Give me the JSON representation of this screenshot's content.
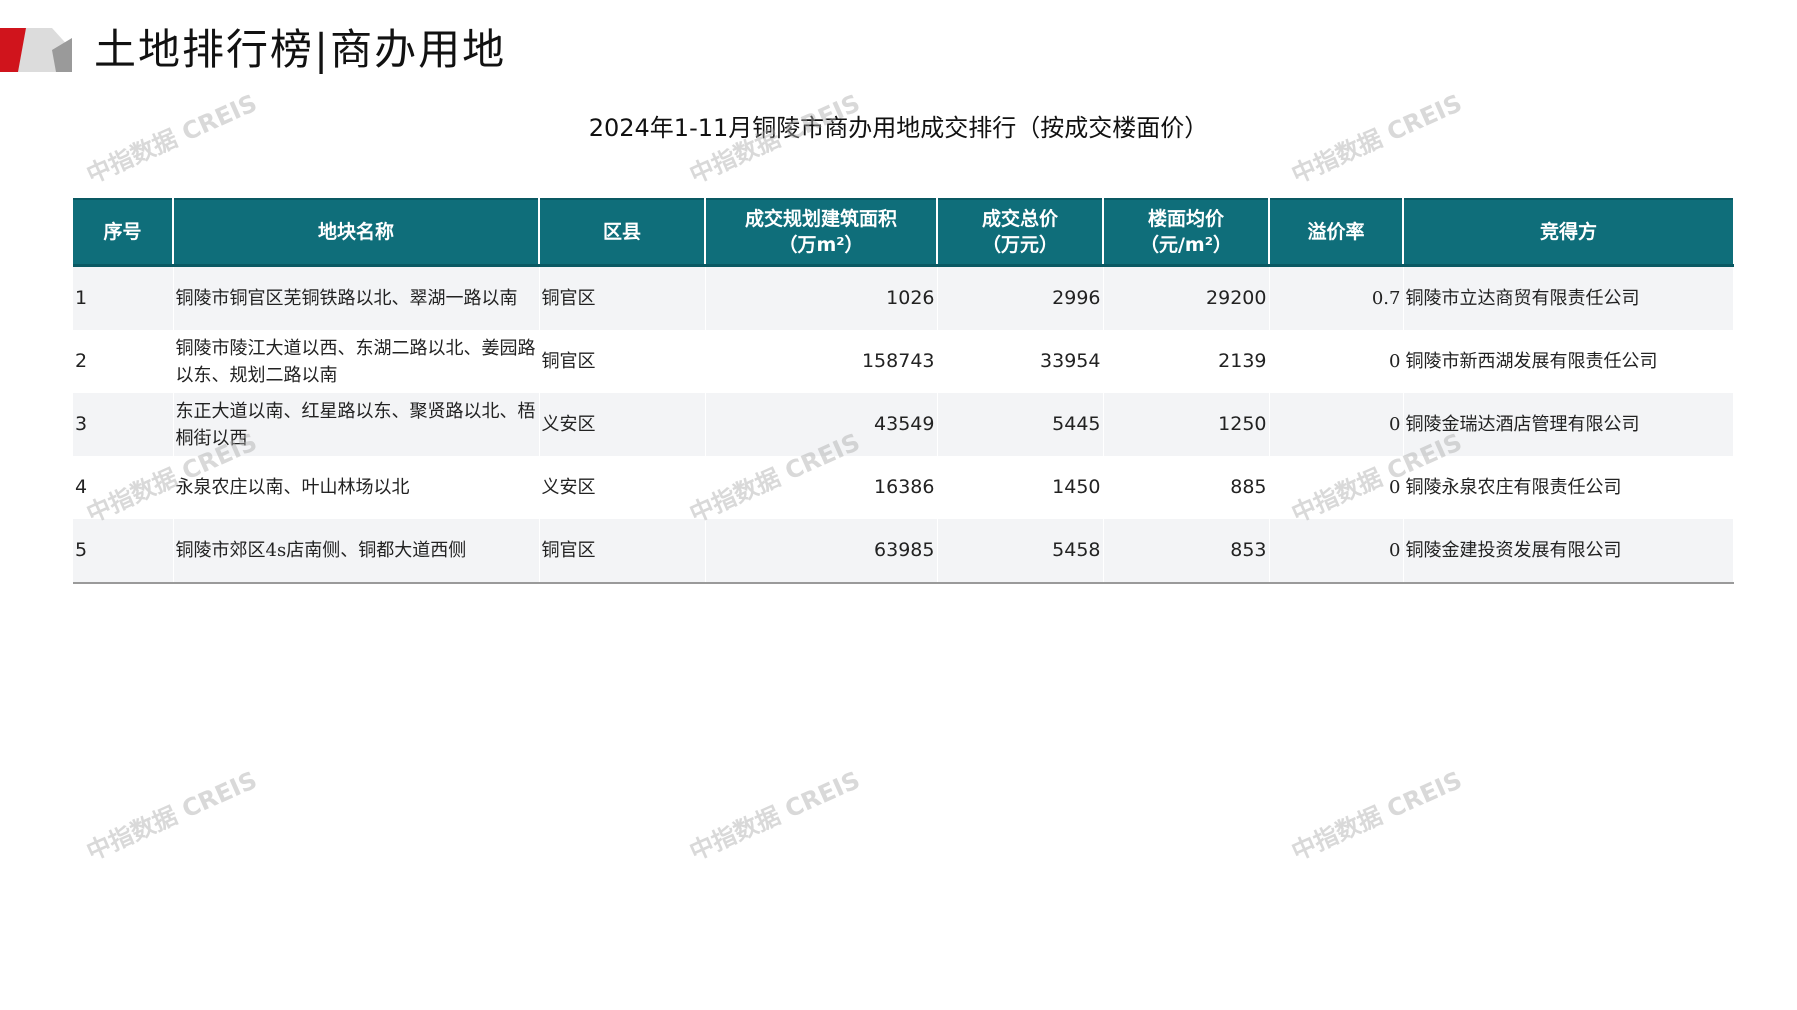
{
  "header": {
    "title": "土地排行榜|商办用地",
    "accent_red": "#d0141c",
    "accent_gray": "#b0b0b0"
  },
  "table": {
    "title": "2024年1-11月铜陵市商办用地成交排行（按成交楼面价）",
    "header_color": "#0f6e7a",
    "highlight_color": "#c00000",
    "columns": [
      "序号",
      "地块名称",
      "区县",
      "成交规划建筑面积\n（万m²）",
      "成交总价\n（万元）",
      "楼面均价\n（元/m²）",
      "溢价率",
      "竞得方"
    ],
    "rows": [
      {
        "rank": "1",
        "name": "铜陵市铜官区芜铜铁路以北、翠湖一路以南",
        "district": "铜官区",
        "area": "1026",
        "total": "2996",
        "price": "29200",
        "premium": "0.7",
        "winner": "铜陵市立达商贸有限责任公司"
      },
      {
        "rank": "2",
        "name": "铜陵市陵江大道以西、东湖二路以北、姜园路以东、规划二路以南",
        "district": "铜官区",
        "area": "158743",
        "total": "33954",
        "price": "2139",
        "premium": "0",
        "winner": "铜陵市新西湖发展有限责任公司"
      },
      {
        "rank": "3",
        "name": "东正大道以南、红星路以东、聚贤路以北、梧桐街以西",
        "district": "义安区",
        "area": "43549",
        "total": "5445",
        "price": "1250",
        "premium": "0",
        "winner": "铜陵金瑞达酒店管理有限公司"
      },
      {
        "rank": "4",
        "name": "永泉农庄以南、叶山林场以北",
        "district": "义安区",
        "area": "16386",
        "total": "1450",
        "price": "885",
        "premium": "0",
        "winner": "铜陵永泉农庄有限责任公司"
      },
      {
        "rank": "5",
        "name": "铜陵市郊区4s店南侧、铜都大道西侧",
        "district": "铜官区",
        "area": "63985",
        "total": "5458",
        "price": "853",
        "premium": "0",
        "winner": "铜陵金建投资发展有限公司"
      }
    ]
  },
  "watermark": {
    "text": "中指数据 CREIS"
  }
}
